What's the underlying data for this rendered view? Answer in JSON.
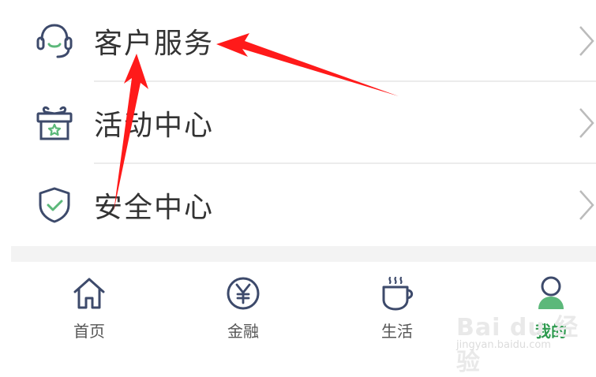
{
  "menu": {
    "items": [
      {
        "label": "客户服务",
        "icon": "headset-icon"
      },
      {
        "label": "活动中心",
        "icon": "gift-icon"
      },
      {
        "label": "安全中心",
        "icon": "shield-check-icon"
      }
    ]
  },
  "tabbar": {
    "tabs": [
      {
        "label": "首页",
        "icon": "home-icon"
      },
      {
        "label": "金融",
        "icon": "yuan-icon"
      },
      {
        "label": "生活",
        "icon": "coffee-cup-icon"
      },
      {
        "label": "我的",
        "icon": "user-icon",
        "active": true
      }
    ]
  },
  "watermark": {
    "main": "Bai du 经验",
    "sub": "jingyan.baidu.com"
  },
  "colors": {
    "accent": "#2e9a4f",
    "icon_stroke": "#3d4a6b",
    "icon_green": "#5cb87a",
    "annotation_arrow": "#ff1a1a"
  }
}
